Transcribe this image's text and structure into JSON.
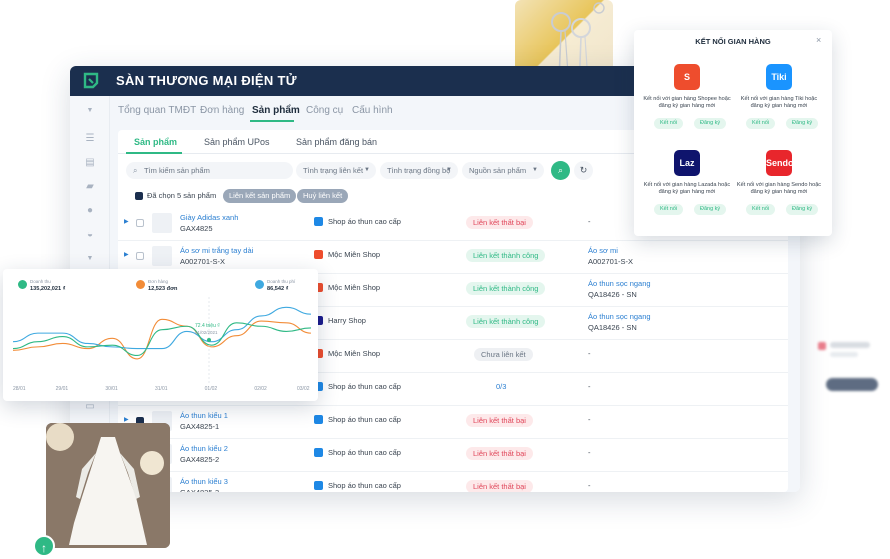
{
  "app": {
    "title": "SÀN THƯƠNG MẠI ĐIỆN TỬ"
  },
  "nav": [
    "Tổng quan TMĐT",
    "Đơn hàng",
    "Sản phẩm",
    "Công cụ",
    "Cấu hình"
  ],
  "subtabs": [
    "Sản phẩm",
    "Sản phẩm UPos",
    "Sản phẩm đăng bán"
  ],
  "filters": {
    "search_placeholder": "Tìm kiếm sản phẩm",
    "link_status": "Tình trạng liên kết",
    "sync_status": "Tình trạng đồng bộ",
    "source": "Nguồn sản phẩm"
  },
  "bulk": {
    "selected": "Đã chọn 5 sản phẩm",
    "link_button": "Liên kết sản phẩm",
    "unlink_button": "Huỷ liên kết"
  },
  "rows": [
    {
      "name": "Giày Adidas xanh",
      "sku": "GAX4825",
      "shop": "Shop áo thun cao cấp",
      "shop_color": "#1e88e5",
      "status": "Liên kết thất bại",
      "status_kind": "fail",
      "linked_name": "",
      "linked_sku": "-",
      "checked": false
    },
    {
      "name": "Áo sơ mi trắng tay dài",
      "sku": "A002701-S-X",
      "shop": "Mộc Miên Shop",
      "shop_color": "#ee4d2d",
      "status": "Liên kết thành công",
      "status_kind": "ok",
      "linked_name": "Áo sơ mi",
      "linked_sku": "A002701-S-X",
      "checked": false
    },
    {
      "name": "",
      "sku": "",
      "shop": "Mộc Miên Shop",
      "shop_color": "#ee4d2d",
      "status": "Liên kết thành công",
      "status_kind": "ok",
      "linked_name": "Áo thun sọc ngang",
      "linked_sku": "QA18426 - SN",
      "checked": false
    },
    {
      "name": "",
      "sku": "",
      "shop": "Harry Shop",
      "shop_color": "#1a1a8c",
      "status": "Liên kết thành công",
      "status_kind": "ok",
      "linked_name": "Áo thun sọc ngang",
      "linked_sku": "QA18426 - SN",
      "checked": false
    },
    {
      "name": "",
      "sku": "",
      "shop": "Mộc Miên Shop",
      "shop_color": "#ee4d2d",
      "status": "Chưa liên kết",
      "status_kind": "none",
      "linked_name": "",
      "linked_sku": "-",
      "checked": false
    },
    {
      "name": "",
      "sku": "",
      "shop": "Shop áo thun cao cấp",
      "shop_color": "#1e88e5",
      "status": "0/3",
      "status_kind": "count",
      "linked_name": "",
      "linked_sku": "-",
      "checked": false
    },
    {
      "name": "Áo thun kiểu 1",
      "sku": "GAX4825-1",
      "shop": "Shop áo thun cao cấp",
      "shop_color": "#1e88e5",
      "status": "Liên kết thất bại",
      "status_kind": "fail",
      "linked_name": "",
      "linked_sku": "-",
      "checked": true
    },
    {
      "name": "Áo thun kiểu 2",
      "sku": "GAX4825-2",
      "shop": "Shop áo thun cao cấp",
      "shop_color": "#1e88e5",
      "status": "Liên kết thất bại",
      "status_kind": "fail",
      "linked_name": "",
      "linked_sku": "-",
      "checked": true
    },
    {
      "name": "Áo thun kiểu 3",
      "sku": "GAX4825-3",
      "shop": "Shop áo thun cao cấp",
      "shop_color": "#1e88e5",
      "status": "Liên kết thất bại",
      "status_kind": "fail",
      "linked_name": "",
      "linked_sku": "-",
      "checked": true
    }
  ],
  "popup": {
    "title": "KẾT NỐI GIAN HÀNG",
    "close": "×",
    "platforms": [
      {
        "logo": "S",
        "color": "#ee4d2d",
        "desc": "Kết nối với gian hàng Shopee hoặc đăng ký gian hàng mới",
        "connect": "Kết nối",
        "register": "Đăng ký"
      },
      {
        "logo": "Tiki",
        "color": "#1a94ff",
        "desc": "Kết nối với gian hàng Tiki hoặc đăng ký gian hàng mới",
        "connect": "Kết nối",
        "register": "Đăng ký"
      },
      {
        "logo": "Laz",
        "color": "#0f146d",
        "desc": "Kết nối với gian hàng Lazada hoặc đăng ký gian hàng mới",
        "connect": "Kết nối",
        "register": "Đăng ký"
      },
      {
        "logo": "Sendo",
        "color": "#e8262c",
        "desc": "Kết nối với gian hàng Sendo hoặc đăng ký gian hàng mới",
        "connect": "Kết nối",
        "register": "Đăng ký"
      }
    ]
  },
  "dashboard": {
    "stats": [
      {
        "label": "Doanh thu",
        "value": "135,202,021 ₫",
        "color": "#2fb985"
      },
      {
        "label": "Đơn hàng",
        "value": "12,523 đơn",
        "color": "#f28c38"
      },
      {
        "label": "Doanh thu phí",
        "value": "86,542 ₫",
        "color": "#3fa9e0"
      }
    ],
    "tooltip": {
      "value": "72.4 triệu ₫",
      "date": "01/02/2021"
    }
  },
  "chart_data": {
    "type": "line",
    "x": [
      "28/01",
      "29/01",
      "30/01",
      "31/01",
      "01/02",
      "02/02",
      "03/02"
    ],
    "series": [
      {
        "color": "#f28c38",
        "values": [
          38,
          42,
          46,
          40,
          52,
          28,
          74,
          66,
          42,
          55,
          72,
          70,
          58
        ]
      },
      {
        "color": "#3fa9e0",
        "values": [
          48,
          58,
          58,
          46,
          42,
          40,
          40,
          60,
          48,
          62,
          78,
          88,
          80
        ]
      },
      {
        "color": "#2fb985",
        "values": [
          40,
          48,
          54,
          42,
          44,
          32,
          62,
          66,
          44,
          70,
          66,
          60,
          64
        ]
      }
    ],
    "ylim": [
      0,
      100
    ]
  },
  "colors": {
    "accent": "#2fb985",
    "header": "#1b2f4e",
    "fail": "#e0465a",
    "link": "#2b7fd1"
  }
}
